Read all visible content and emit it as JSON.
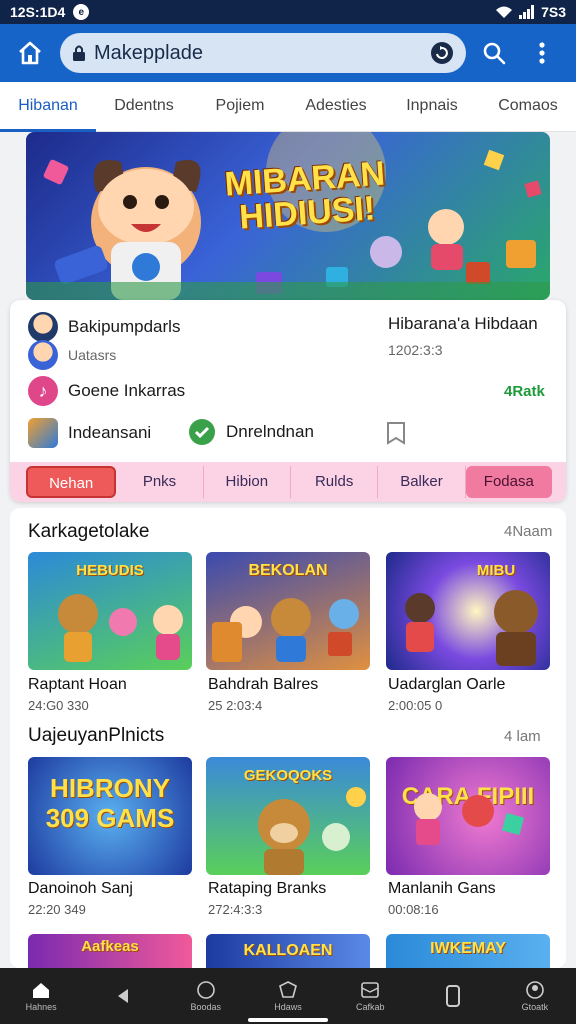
{
  "status_bar": {
    "time": "12S:1D4",
    "battery": "7S3"
  },
  "browser": {
    "url": "Makepplade"
  },
  "tabs": [
    "Hibanan",
    "Ddentns",
    "Pojiem",
    "Adesties",
    "Inpnais",
    "Comaos"
  ],
  "banner": {
    "title": "MIBARAN HIDIUSI!"
  },
  "info": {
    "row1_name": "Bakipumpdarls",
    "row1_sub": "Uatasrs",
    "row1_right": "Hibarana'a Hibdaan",
    "row1_right_sub": "1202:3:3",
    "row2_name": "Goene Inkarras",
    "row2_right": "4Ratk",
    "row3_item1": "Indeansani",
    "row3_item2": "Dnrelndnan"
  },
  "categories": [
    "Nehan",
    "Pnks",
    "Hibion",
    "Rulds",
    "Balker",
    "Fodasa"
  ],
  "section1": {
    "title": "Karkagetolake",
    "more": "4Naam",
    "games": [
      {
        "name": "Raptant Hoan",
        "sub": "24:G0 330",
        "thumb_label": "HEBUDIS"
      },
      {
        "name": "Bahdrah Balres",
        "sub": "25 2:03:4",
        "thumb_label": "BEKOLAN"
      },
      {
        "name": "Uadarglan Oarle",
        "sub": "2:00:05 0",
        "thumb_label": "MIBU"
      }
    ]
  },
  "section2": {
    "title": "UajeuyanPlnicts",
    "more": "4 lam",
    "games": [
      {
        "name": "Danoinoh Sanj",
        "sub": "22:20 349",
        "thumb_label": "HIBRONY 309 GAMS"
      },
      {
        "name": "Rataping Branks",
        "sub": "272:4:3:3",
        "thumb_label": "GEKOQOKS"
      },
      {
        "name": "Manlanih Gans",
        "sub": "00:08:16",
        "thumb_label": "CARA FIPIII"
      }
    ]
  },
  "section3_labels": [
    "Aafkeas",
    "KALLOAEN",
    "IWKEMAY"
  ],
  "bottom_nav": [
    "Hahnes",
    "",
    "Boodas",
    "Hdaws",
    "Cafkab",
    "",
    "Gtoatk"
  ],
  "colors": {
    "appbar": "#1664c8",
    "status": "#10244a",
    "accent": "#1a5fc4",
    "category_bg": "#fbd3e4",
    "category_active": "#ee5a5a"
  }
}
